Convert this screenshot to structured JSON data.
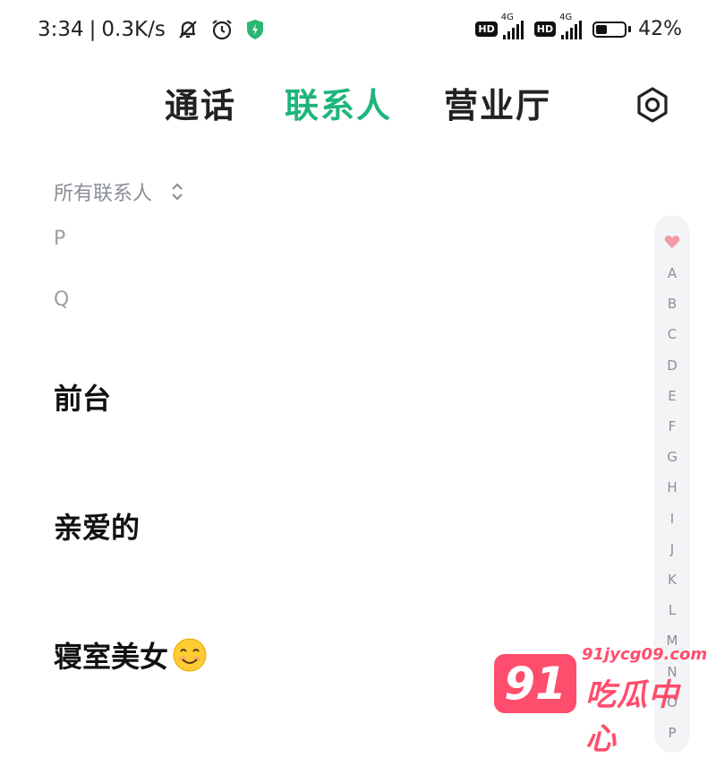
{
  "status_bar": {
    "time": "3:34",
    "separator": "|",
    "net_speed": "0.3K/s",
    "hd": "HD",
    "network_1": "4G",
    "network_2": "4G",
    "battery": "42%",
    "battery_level": 0.42,
    "icons": [
      "mute-icon",
      "alarm-icon",
      "shield-icon",
      "signal-icon",
      "battery-icon"
    ]
  },
  "tabs": [
    {
      "label": "通话",
      "active": false
    },
    {
      "label": "联系人",
      "active": true
    },
    {
      "label": "营业厅",
      "active": false
    }
  ],
  "accent_color": "#1fb57c",
  "filter": {
    "label": "所有联系人"
  },
  "sections": {
    "p": "P",
    "q": "Q"
  },
  "contacts": [
    {
      "name": "前台"
    },
    {
      "name": "亲爱的"
    },
    {
      "name": "寝室美女"
    }
  ],
  "index_letters": [
    "A",
    "B",
    "C",
    "D",
    "E",
    "F",
    "G",
    "H",
    "I",
    "J",
    "K",
    "L",
    "M",
    "N",
    "O",
    "P"
  ],
  "watermark": {
    "badge": "91",
    "url": "91jycg09.com",
    "name": "吃瓜中心",
    "color": "#ff4d6d"
  }
}
